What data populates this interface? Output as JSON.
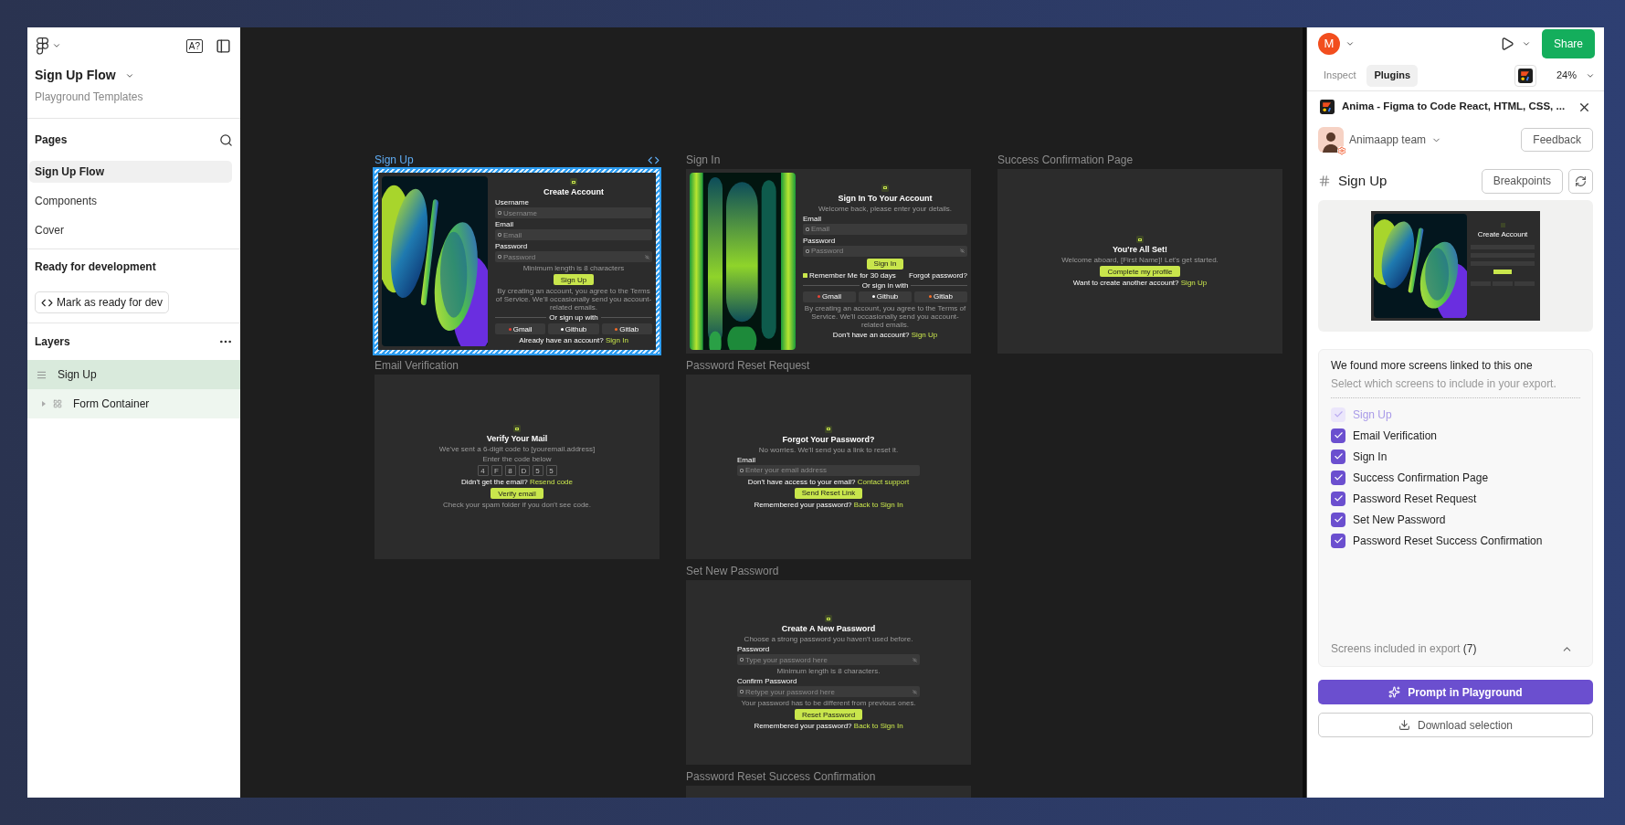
{
  "sidebar": {
    "file_title": "Sign Up Flow",
    "team": "Playground Templates",
    "badge": "A?",
    "pages_title": "Pages",
    "pages": [
      {
        "label": "Sign Up Flow",
        "selected": true
      },
      {
        "label": "Components",
        "selected": false
      },
      {
        "label": "Cover",
        "selected": false
      }
    ],
    "dev_title": "Ready for development",
    "dev_button": "Mark as ready for dev",
    "layers_title": "Layers",
    "layers": [
      {
        "label": "Sign Up",
        "selected": true,
        "expanded": true,
        "children": [
          {
            "label": "Form Container",
            "selected": false,
            "expanded": false
          }
        ]
      }
    ]
  },
  "canvas": {
    "columns": [
      {
        "frames": [
          {
            "label": "Sign Up",
            "selected": true,
            "kind": "split",
            "blocks": [
              {
                "kind": "title",
                "text": "Create Account"
              },
              {
                "kind": "field",
                "label": "Username",
                "placeholder": "Username",
                "masked": false
              },
              {
                "kind": "field",
                "label": "Email",
                "placeholder": "Email",
                "masked": false
              },
              {
                "kind": "field",
                "label": "Password",
                "placeholder": "Password",
                "masked": true
              },
              {
                "kind": "note",
                "text": "Minimum length is 8 characters"
              },
              {
                "kind": "button",
                "text": "Sign Up"
              },
              {
                "kind": "note",
                "text": "By creating an account, you agree to the Terms of Service. We'll occasionally send you account-related emails."
              },
              {
                "kind": "divider",
                "text": "Or sign up with"
              },
              {
                "kind": "socials",
                "items": [
                  "Gmail",
                  "Github",
                  "Gitlab"
                ]
              },
              {
                "kind": "prompt",
                "text": "Already have an account?",
                "link": "Sign In"
              }
            ]
          },
          {
            "label": "Email Verification",
            "selected": false,
            "kind": "centered",
            "blocks": [
              {
                "kind": "title",
                "text": "Verify Your Mail"
              },
              {
                "kind": "subtitle",
                "text": "We've sent a 6-digit code to [youremail.address]"
              },
              {
                "kind": "note",
                "text": "Enter the code below"
              },
              {
                "kind": "code",
                "digits": [
                  "4",
                  "F",
                  "8",
                  "D",
                  "5",
                  "5"
                ]
              },
              {
                "kind": "prompt",
                "text": "Didn't get the email?",
                "link": "Resend code"
              },
              {
                "kind": "button",
                "text": "Verify email"
              },
              {
                "kind": "note",
                "text": "Check your spam folder if you don't see code."
              }
            ]
          }
        ]
      },
      {
        "frames": [
          {
            "label": "Sign In",
            "selected": false,
            "kind": "split",
            "blocks": [
              {
                "kind": "title",
                "text": "Sign In To Your Account"
              },
              {
                "kind": "subtitle",
                "text": "Welcome back, please enter your details."
              },
              {
                "kind": "field",
                "label": "Email",
                "placeholder": "Email",
                "masked": false
              },
              {
                "kind": "field",
                "label": "Password",
                "placeholder": "Password",
                "masked": true
              },
              {
                "kind": "button",
                "text": "Sign In"
              },
              {
                "kind": "options",
                "left": "Remember Me for 30 days",
                "right": "Forgot password?",
                "checked": true
              },
              {
                "kind": "divider",
                "text": "Or sign in with"
              },
              {
                "kind": "socials",
                "items": [
                  "Gmail",
                  "Github",
                  "Gitlab"
                ]
              },
              {
                "kind": "note",
                "text": "By creating an account, you agree to the Terms of Service. We'll occasionally send you account-related emails."
              },
              {
                "kind": "prompt",
                "text": "Don't have an account?",
                "link": "Sign Up"
              }
            ]
          },
          {
            "label": "Password Reset Request",
            "selected": false,
            "kind": "centered",
            "blocks": [
              {
                "kind": "title",
                "text": "Forgot Your Password?"
              },
              {
                "kind": "subtitle",
                "text": "No worries. We'll send you a link to reset it."
              },
              {
                "kind": "field",
                "label": "Email",
                "placeholder": "Enter your email address",
                "masked": false
              },
              {
                "kind": "prompt",
                "text": "Don't have access to your email?",
                "link": "Contact support"
              },
              {
                "kind": "button",
                "text": "Send Reset Link"
              },
              {
                "kind": "prompt",
                "text": "Remembered your password?",
                "link": "Back to Sign In"
              }
            ]
          },
          {
            "label": "Set New Password",
            "selected": false,
            "kind": "centered",
            "blocks": [
              {
                "kind": "title",
                "text": "Create A New Password"
              },
              {
                "kind": "subtitle",
                "text": "Choose a strong password you haven't used before."
              },
              {
                "kind": "field",
                "label": "Password",
                "placeholder": "Type your password here",
                "masked": true
              },
              {
                "kind": "note",
                "text": "Minimum length is 8 characters."
              },
              {
                "kind": "field",
                "label": "Confirm Password",
                "placeholder": "Retype your password here",
                "masked": true
              },
              {
                "kind": "note",
                "text": "Your password has to be different from previous ones."
              },
              {
                "kind": "button",
                "text": "Reset Password"
              },
              {
                "kind": "prompt",
                "text": "Remembered your password?",
                "link": "Back to Sign In"
              }
            ]
          },
          {
            "label": "Password Reset Success Confirmation",
            "selected": false,
            "kind": "centered"
          }
        ]
      },
      {
        "frames": [
          {
            "label": "Success Confirmation Page",
            "selected": false,
            "kind": "centered",
            "blocks": [
              {
                "kind": "title",
                "text": "You're All Set!"
              },
              {
                "kind": "subtitle",
                "text": "Welcome aboard, [First Name]! Let's get started."
              },
              {
                "kind": "button",
                "text": "Complete my profile"
              },
              {
                "kind": "prompt",
                "text": "Want to create another account?",
                "link": "Sign Up"
              }
            ]
          }
        ]
      }
    ]
  },
  "panel": {
    "avatar": "M",
    "share": "Share",
    "tabs": [
      {
        "label": "Inspect",
        "selected": false
      },
      {
        "label": "Plugins",
        "selected": true
      }
    ],
    "zoom": "24%",
    "plugin_title": "Anima - Figma to Code React, HTML, CSS, ...",
    "team": "Animaapp team",
    "feedback": "Feedback",
    "screen_title": "Sign Up",
    "breakpoints": "Breakpoints",
    "preview_title": "Create Account",
    "linked_title": "We found more screens linked to this one",
    "linked_subtitle": "Select which screens to include in your export.",
    "screens": [
      {
        "label": "Sign Up",
        "checked": true,
        "disabled": true
      },
      {
        "label": "Email Verification",
        "checked": true,
        "disabled": false
      },
      {
        "label": "Sign In",
        "checked": true,
        "disabled": false
      },
      {
        "label": "Success Confirmation Page",
        "checked": true,
        "disabled": false
      },
      {
        "label": "Password Reset Request",
        "checked": true,
        "disabled": false
      },
      {
        "label": "Set New Password",
        "checked": true,
        "disabled": false
      },
      {
        "label": "Password Reset Success Confirmation",
        "checked": true,
        "disabled": false
      }
    ],
    "included_label": "Screens included in export",
    "included_count": "(7)",
    "included_expanded": true,
    "prompt_button": "Prompt in Playground",
    "download_button": "Download selection"
  }
}
